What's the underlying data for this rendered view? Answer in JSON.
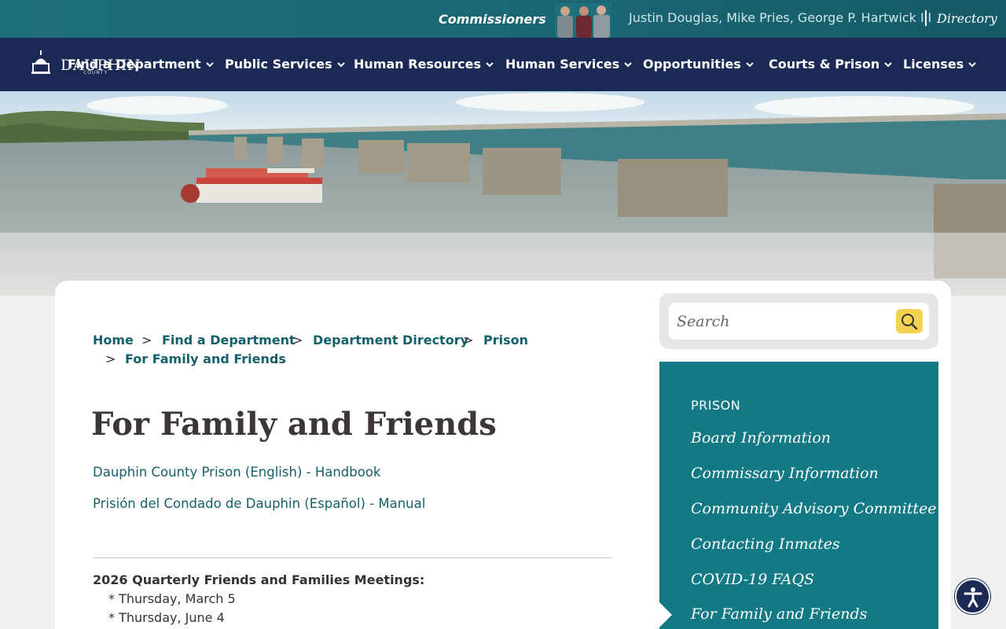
{
  "topbar": {
    "commissioners_label": "Commissioners",
    "commissioner_names": "Justin Douglas, Mike Pries, George P. Hartwick III",
    "directory_label": "Directory"
  },
  "logo": {
    "name": "DAUPHIN",
    "sub": "COUNTY"
  },
  "nav": {
    "items": [
      {
        "label": "Find a Department"
      },
      {
        "label": "Public Services"
      },
      {
        "label": "Human Resources"
      },
      {
        "label": "Human Services"
      },
      {
        "label": "Opportunities"
      },
      {
        "label": "Courts & Prison"
      },
      {
        "label": "Licenses"
      }
    ]
  },
  "breadcrumb": {
    "items": [
      "Home",
      "Find a Department",
      "Department Directory",
      "Prison",
      "For Family and Friends"
    ],
    "separator": ">",
    "trailing": ":"
  },
  "page": {
    "title": "For Family and Friends",
    "links": [
      "Dauphin County Prison (English) - Handbook",
      "Prisión del Condado de Dauphin (Español) - Manual"
    ],
    "meetings_title": "2026 Quarterly Friends and Families Meetings:",
    "meetings": [
      "* Thursday, March 5",
      "* Thursday, June 4"
    ]
  },
  "search": {
    "placeholder": "Search"
  },
  "sidenav": {
    "heading": "PRISON",
    "items": [
      "Board Information",
      "Commissary Information",
      "Community Advisory Committee",
      "Contacting Inmates",
      "COVID-19 FAQS",
      "For Family and Friends"
    ],
    "active_index": 5
  },
  "colors": {
    "topbar": "#1d6f7a",
    "nav": "#1a2a55",
    "link": "#14606b",
    "sidenav": "#137a85",
    "search_button": "#f3d24f"
  },
  "icons": [
    "capitol-dome-icon",
    "chevron-down-icon",
    "search-icon",
    "accessibility-icon"
  ]
}
